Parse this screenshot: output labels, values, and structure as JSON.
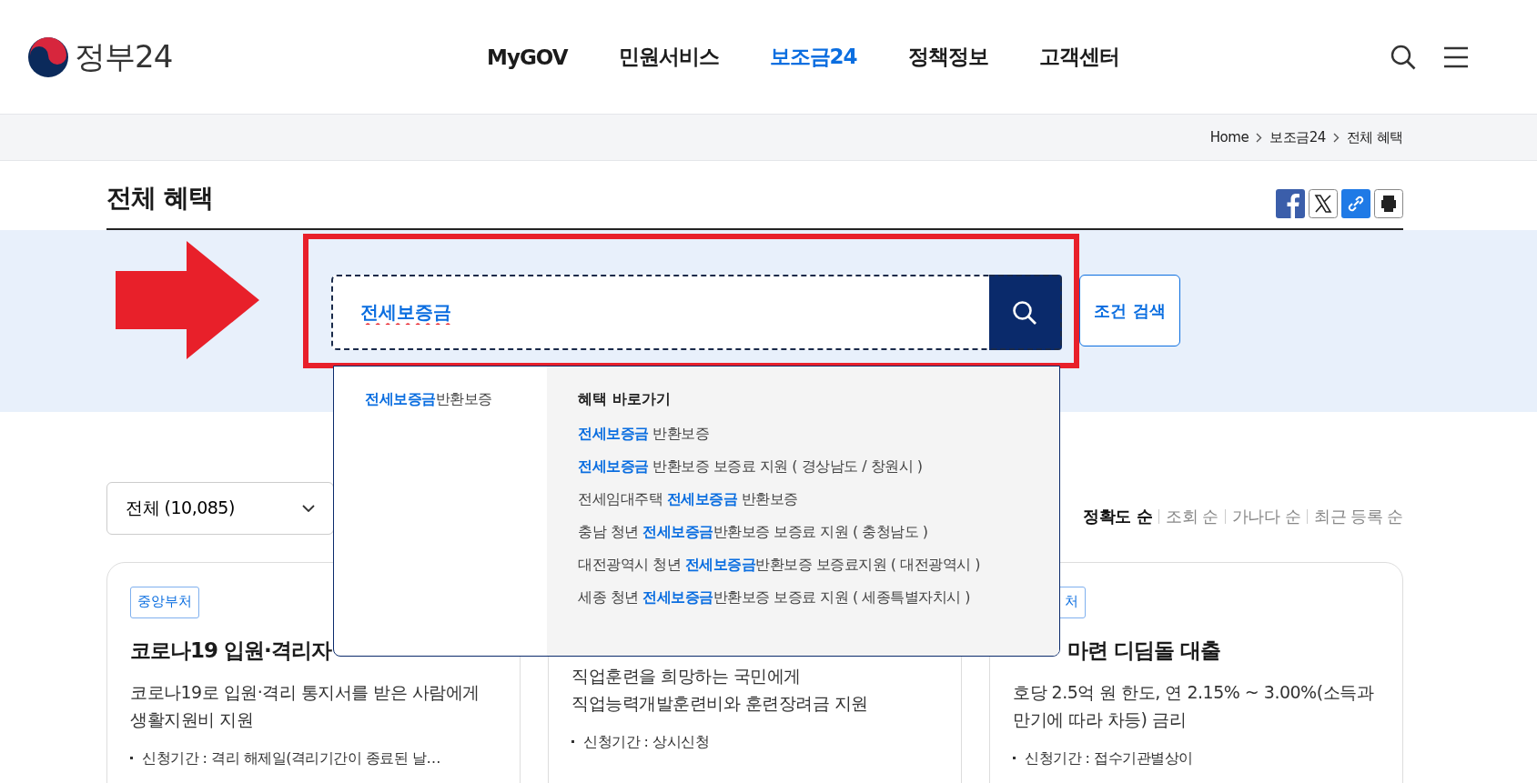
{
  "header": {
    "logo_text": "정부24",
    "nav": [
      {
        "label": "MyGOV",
        "selected": false
      },
      {
        "label": "민원서비스",
        "selected": false
      },
      {
        "label": "보조금24",
        "selected": true
      },
      {
        "label": "정책정보",
        "selected": false
      },
      {
        "label": "고객센터",
        "selected": false
      }
    ]
  },
  "breadcrumb": [
    "Home",
    "보조금24",
    "전체 혜택"
  ],
  "page_title": "전체 혜택",
  "search": {
    "value": "전세보증금",
    "filter_button": "조건 검색"
  },
  "autocomplete": {
    "suggestions": [
      "**전세보증금**반환보증"
    ],
    "shortcut_heading": "혜택 바로가기",
    "shortcuts": [
      "**전세보증금** 반환보증",
      "**전세보증금** 반환보증 보증료 지원 ( 경상남도 / 창원시 )",
      "전세임대주택 **전세보증금** 반환보증",
      "충남 청년 **전세보증금**반환보증 보증료 지원 ( 충청남도 )",
      "대전광역시 청년 **전세보증금**반환보증 보증료지원 ( 대전광역시 )",
      "세종 청년 **전세보증금**반환보증 보증료 지원 ( 세종특별자치시 )"
    ]
  },
  "category_select": {
    "value": "전체 (10,085)"
  },
  "sort": [
    {
      "label": "정확도 순",
      "selected": true
    },
    {
      "label": "조회 순",
      "selected": false
    },
    {
      "label": "가나다 순",
      "selected": false
    },
    {
      "label": "최근 등록 순",
      "selected": false
    }
  ],
  "cards": [
    {
      "tag": "중앙부처",
      "title": "코로나19 입원·격리자",
      "description": "코로나19로 입원·격리 통지서를 받은 사람에게\n생활지원비 지원",
      "period": "신청기간 : 격리 해제일(격리기간이 종료된 날…"
    },
    {
      "description": "직업훈련을 희망하는 국민에게\n직업능력개발훈련비와 훈련장려금 지원",
      "period": "신청기간 : 상시신청"
    },
    {
      "tag": "처",
      "title": "마련 디딤돌 대출",
      "description": "호당 2.5억 원 한도, 연 2.15% ~ 3.00%(소득과\n만기에 따라 차등) 금리",
      "period": "신청기간 : 접수기관별상이"
    }
  ]
}
